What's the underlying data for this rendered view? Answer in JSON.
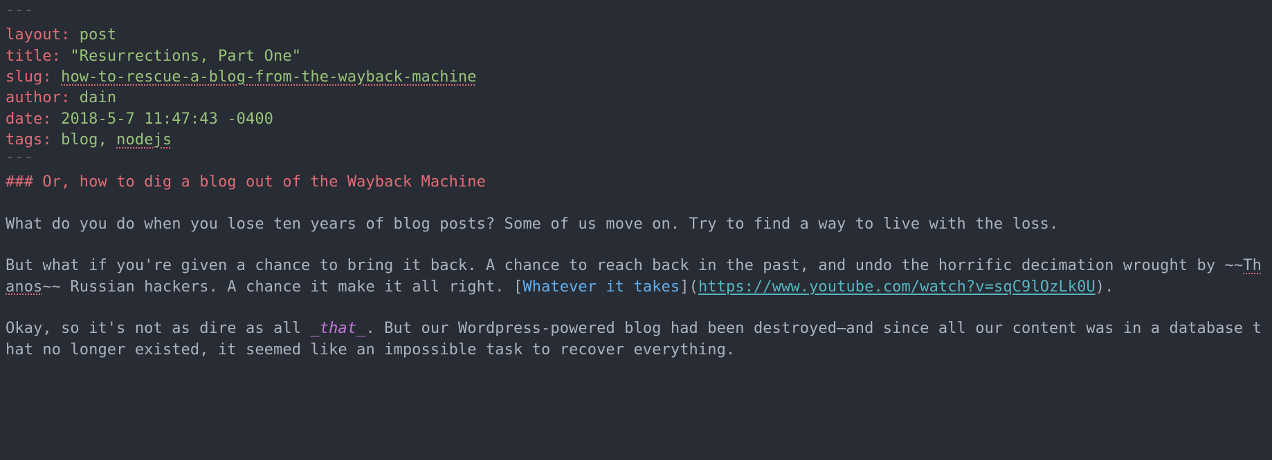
{
  "delim": "---",
  "front": {
    "layout_key": "layout",
    "layout_val": "post",
    "title_key": "title",
    "title_val": "\"Resurrections, Part One\"",
    "slug_key": "slug",
    "slug_val": "how-to-rescue-a-blog-from-the-wayback-machine",
    "author_key": "author",
    "author_val": "dain",
    "date_key": "date",
    "date_val": "2018-5-7 11:47:43 -0400",
    "tags_key": "tags",
    "tags_val_a": "blog, ",
    "tags_val_b": "nodejs"
  },
  "heading": "### Or, how to dig a blog out of the Wayback Machine",
  "p1": "What do you do when you lose ten years of blog posts? Some of us move on. Try to find a way to live with the loss.",
  "p2a": "But what if you're given a chance to bring it back. A chance to reach back in the past, and undo the horrific decimation wrought by ~~",
  "p2_strike": "Thanos",
  "p2b": "~~ Russian hackers. A chance it make it all right. ",
  "link_open": "[",
  "link_text": "Whatever it takes",
  "link_mid": "](",
  "link_url_1": "https://www.youtube.com/",
  "link_url_2": "watch?v=sqC9lOzLk0U",
  "link_close": ")",
  "p2c": ".",
  "p3a": "Okay, so it's not as dire as all ",
  "p3_emph": "_that_",
  "p3b": ". But our Wordpress-powered blog had been destroyed—and since all our content was in a database that no longer existed, it seemed like an impossible task to recover everything."
}
